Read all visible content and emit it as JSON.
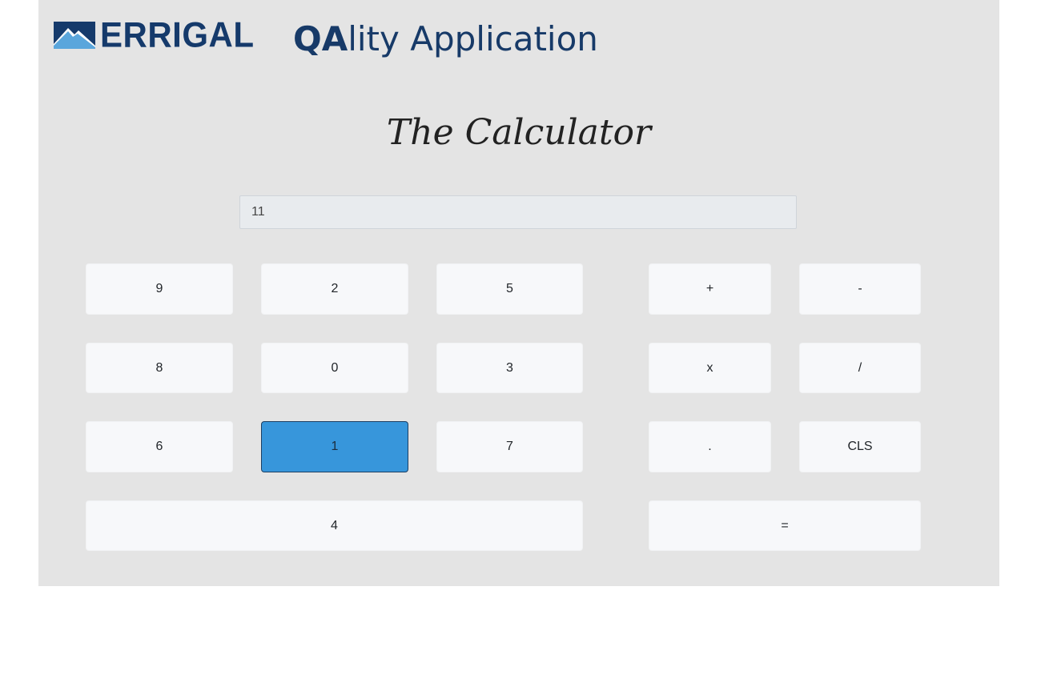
{
  "header": {
    "logo_text": "ERRIGAL",
    "title_bold": "QA",
    "title_rest": "lity Application",
    "brand_color": "#153a6b"
  },
  "page": {
    "heading": "The Calculator"
  },
  "calculator": {
    "display_value": "11",
    "active_key": "1",
    "active_color": "#3796db",
    "digits": {
      "k9": "9",
      "k2": "2",
      "k5": "5",
      "k8": "8",
      "k0": "0",
      "k3": "3",
      "k6": "6",
      "k1": "1",
      "k7": "7",
      "k4": "4"
    },
    "operators": {
      "plus": "+",
      "minus": "-",
      "multiply": "x",
      "divide": "/",
      "decimal": ".",
      "clear": "CLS",
      "equals": "="
    }
  }
}
